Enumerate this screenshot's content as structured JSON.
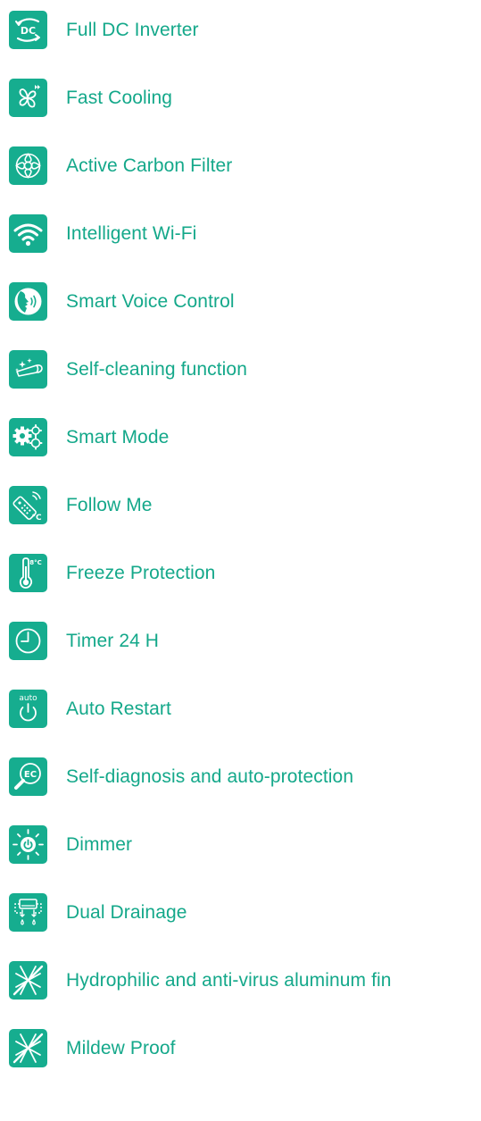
{
  "accent_color": "#16ad8f",
  "text_color": "#14a88a",
  "features": [
    {
      "label": "Full DC Inverter",
      "icon": "dc-inverter-icon"
    },
    {
      "label": "Fast Cooling",
      "icon": "fan-icon"
    },
    {
      "label": "Active Carbon Filter",
      "icon": "filter-icon"
    },
    {
      "label": "Intelligent Wi-Fi",
      "icon": "wifi-icon"
    },
    {
      "label": "Smart Voice Control",
      "icon": "voice-icon"
    },
    {
      "label": "Self-cleaning function",
      "icon": "self-clean-icon"
    },
    {
      "label": "Smart Mode",
      "icon": "gears-icon"
    },
    {
      "label": "Follow Me",
      "icon": "remote-icon"
    },
    {
      "label": "Freeze Protection",
      "icon": "thermometer-icon"
    },
    {
      "label": "Timer 24 H",
      "icon": "clock-icon"
    },
    {
      "label": "Auto Restart",
      "icon": "power-icon"
    },
    {
      "label": "Self-diagnosis and auto-protection",
      "icon": "diagnosis-icon"
    },
    {
      "label": "Dimmer",
      "icon": "dimmer-icon"
    },
    {
      "label": "Dual Drainage",
      "icon": "drainage-icon"
    },
    {
      "label": "Hydrophilic and anti-virus aluminum fin",
      "icon": "fin-icon"
    },
    {
      "label": "Mildew Proof",
      "icon": "mildew-icon"
    }
  ],
  "icon_texts": {
    "dc": "DC",
    "auto": "auto",
    "ec": "EC",
    "temp_c": "°C",
    "temp_8c": "8°C"
  }
}
